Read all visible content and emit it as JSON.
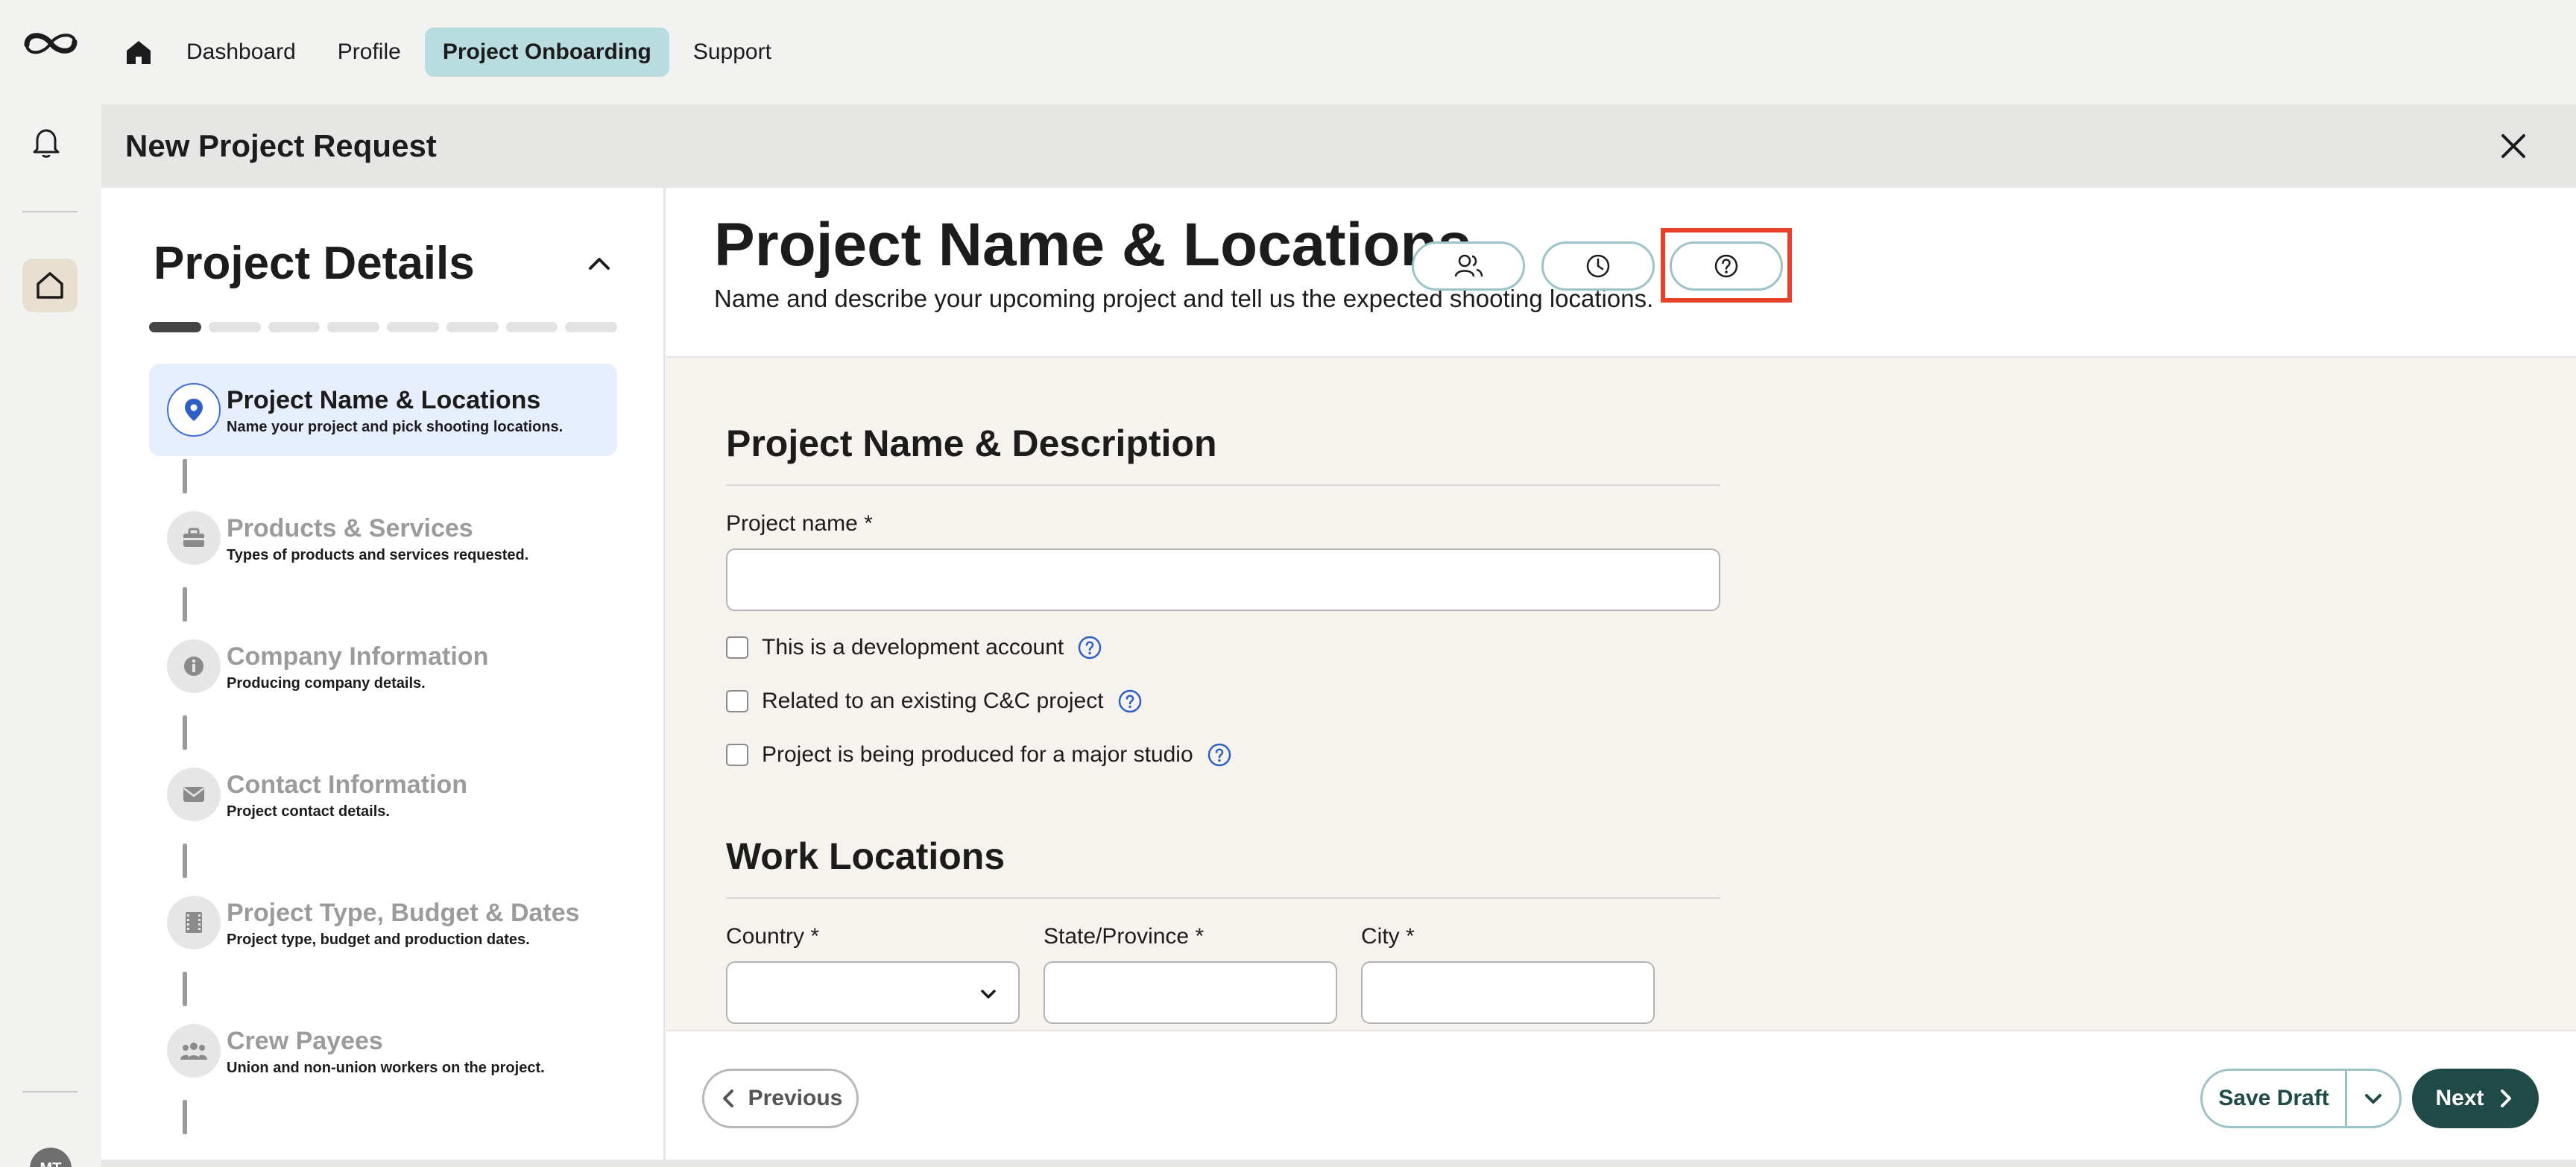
{
  "nav": {
    "items": [
      {
        "label": "Dashboard"
      },
      {
        "label": "Profile"
      },
      {
        "label": "Project Onboarding",
        "active": true
      },
      {
        "label": "Support"
      }
    ]
  },
  "rail": {
    "avatar_initials": "MT"
  },
  "modal": {
    "title": "New Project Request"
  },
  "steps_panel": {
    "heading": "Project Details",
    "progress": {
      "completed": 1,
      "total": 8
    },
    "items": [
      {
        "title": "Project Name & Locations",
        "subtitle": "Name your project and pick shooting locations.",
        "icon": "location-pin-icon",
        "active": true
      },
      {
        "title": "Products & Services",
        "subtitle": "Types of products and services requested.",
        "icon": "toolbox-icon"
      },
      {
        "title": "Company Information",
        "subtitle": "Producing company details.",
        "icon": "info-icon"
      },
      {
        "title": "Contact Information",
        "subtitle": "Project contact details.",
        "icon": "envelope-icon"
      },
      {
        "title": "Project Type, Budget & Dates",
        "subtitle": "Project type, budget and production dates.",
        "icon": "film-icon"
      },
      {
        "title": "Crew Payees",
        "subtitle": "Union and non-union workers on the project.",
        "icon": "people-icon"
      }
    ]
  },
  "main": {
    "title": "Project Name & Locations",
    "description": "Name and describe your upcoming project and tell us the expected shooting locations.",
    "section1": {
      "title": "Project Name & Description",
      "project_name_label": "Project name *",
      "project_name_value": "",
      "checkboxes": [
        {
          "label": "This is a development account",
          "checked": false
        },
        {
          "label": "Related to an existing C&C project",
          "checked": false
        },
        {
          "label": "Project is being produced for a major studio",
          "checked": false
        }
      ]
    },
    "section2": {
      "title": "Work Locations",
      "country_label": "Country *",
      "country_value": "",
      "state_label": "State/Province *",
      "state_value": "",
      "city_label": "City *",
      "city_value": ""
    }
  },
  "footer": {
    "previous_label": "Previous",
    "save_draft_label": "Save Draft",
    "next_label": "Next"
  },
  "colors": {
    "accent_teal": "#1f4a48",
    "nav_active_bg": "#b9dcdf",
    "active_step_bg": "#e7efff",
    "highlight_red": "#e8412a"
  }
}
